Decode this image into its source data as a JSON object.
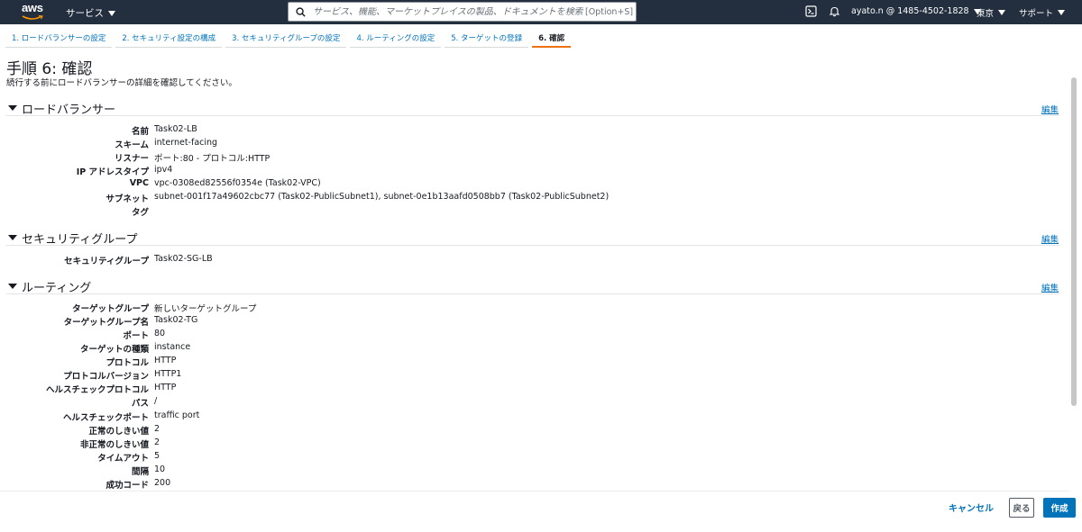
{
  "topnav": {
    "logo_text": "aws",
    "services_label": "サービス",
    "search_placeholder": "サービス、機能、マーケットプレイスの製品、ドキュメントを検索",
    "search_shortcut": "[Option+S]",
    "account_label": "ayato.n @ 1485-4502-1828",
    "region_label": "東京",
    "support_label": "サポート"
  },
  "steps": [
    {
      "label": "1. ロードバランサーの設定",
      "active": false
    },
    {
      "label": "2. セキュリティ設定の構成",
      "active": false
    },
    {
      "label": "3. セキュリティグループの設定",
      "active": false
    },
    {
      "label": "4. ルーティングの設定",
      "active": false
    },
    {
      "label": "5. ターゲットの登録",
      "active": false
    },
    {
      "label": "6. 確認",
      "active": true
    }
  ],
  "page": {
    "title": "手順 6: 確認",
    "description": "続行する前にロードバランサーの詳細を確認してください。"
  },
  "edit_label": "編集",
  "sections": {
    "load_balancer": {
      "title": "ロードバランサー",
      "rows": [
        {
          "key": "名前",
          "value": "Task02-LB"
        },
        {
          "key": "スキーム",
          "value": "internet-facing"
        },
        {
          "key": "リスナー",
          "value": "ポート:80 - プロトコル:HTTP"
        },
        {
          "key": "IP アドレスタイプ",
          "value": "ipv4"
        },
        {
          "key": "VPC",
          "value": "vpc-0308ed82556f0354e (Task02-VPC)"
        },
        {
          "key": "サブネット",
          "value": "subnet-001f17a49602cbc77 (Task02-PublicSubnet1), subnet-0e1b13aafd0508bb7 (Task02-PublicSubnet2)"
        },
        {
          "key": "タグ",
          "value": ""
        }
      ]
    },
    "security_group": {
      "title": "セキュリティグループ",
      "rows": [
        {
          "key": "セキュリティグループ",
          "value": "Task02-SG-LB"
        }
      ]
    },
    "routing": {
      "title": "ルーティング",
      "rows": [
        {
          "key": "ターゲットグループ",
          "value": "新しいターゲットグループ"
        },
        {
          "key": "ターゲットグループ名",
          "value": "Task02-TG"
        },
        {
          "key": "ポート",
          "value": "80"
        },
        {
          "key": "ターゲットの種類",
          "value": "instance"
        },
        {
          "key": "プロトコル",
          "value": "HTTP"
        },
        {
          "key": "プロトコルバージョン",
          "value": "HTTP1"
        },
        {
          "key": "ヘルスチェックプロトコル",
          "value": "HTTP"
        },
        {
          "key": "パス",
          "value": "/"
        },
        {
          "key": "ヘルスチェックポート",
          "value": "traffic port"
        },
        {
          "key": "正常のしきい値",
          "value": "2"
        },
        {
          "key": "非正常のしきい値",
          "value": "2"
        },
        {
          "key": "タイムアウト",
          "value": "5"
        },
        {
          "key": "間隔",
          "value": "10"
        },
        {
          "key": "成功コード",
          "value": "200"
        }
      ]
    }
  },
  "footer": {
    "cancel_label": "キャンセル",
    "back_label": "戻る",
    "create_label": "作成"
  },
  "colors": {
    "nav_bg": "#232f3e",
    "link": "#0073bb",
    "active_step": "#ec7211",
    "primary_button": "#0073bb"
  }
}
